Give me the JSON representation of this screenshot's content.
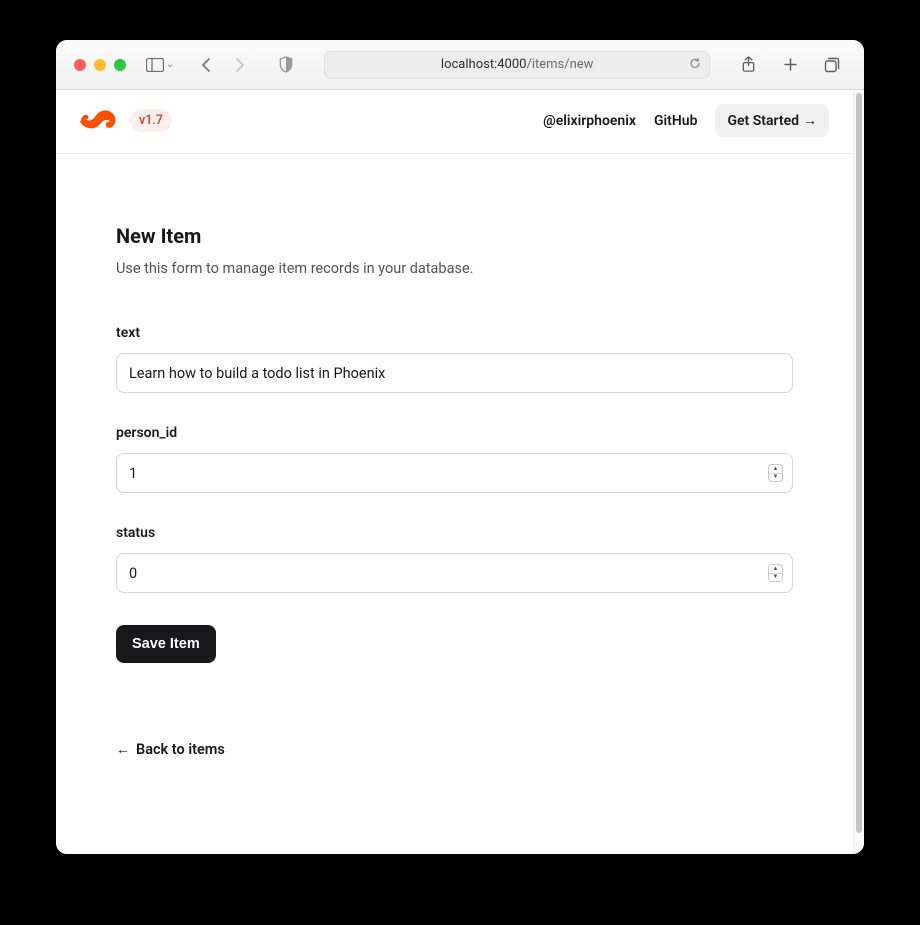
{
  "browser": {
    "url_host": "localhost:4000",
    "url_path": "/items/new"
  },
  "nav": {
    "version": "v1.7",
    "twitter": "@elixirphoenix",
    "github": "GitHub",
    "get_started": "Get Started"
  },
  "page": {
    "title": "New Item",
    "subtitle": "Use this form to manage item records in your database."
  },
  "form": {
    "text": {
      "label": "text",
      "value": "Learn how to build a todo list in Phoenix"
    },
    "person_id": {
      "label": "person_id",
      "value": "1"
    },
    "status": {
      "label": "status",
      "value": "0"
    },
    "submit": "Save Item"
  },
  "back_link": "Back to items"
}
